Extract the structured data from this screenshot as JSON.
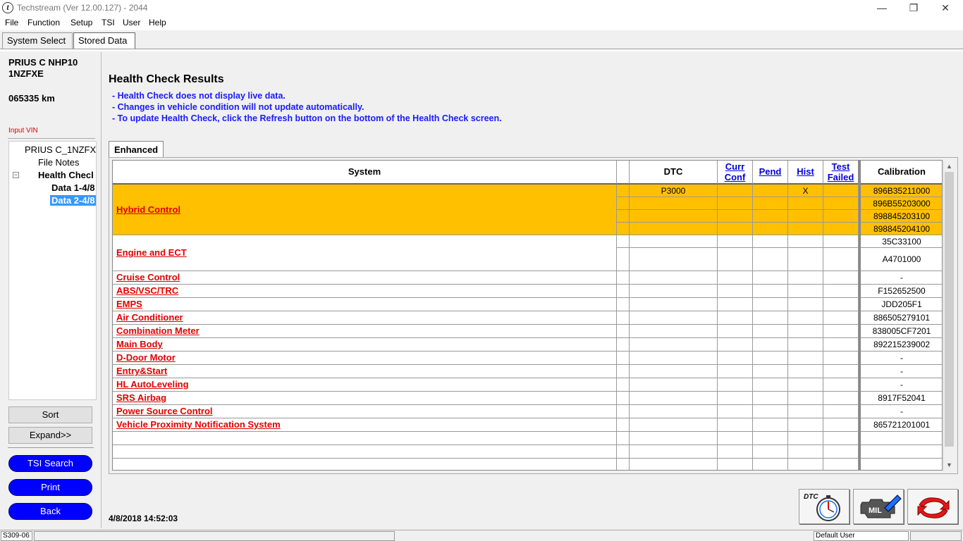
{
  "window": {
    "title": "Techstream (Ver 12.00.127) - 2044",
    "icon_glyph": "t",
    "min_glyph": "—",
    "max_glyph": "❐",
    "close_glyph": "✕"
  },
  "menu": [
    "File",
    "Function",
    "Setup",
    "TSI",
    "User",
    "Help"
  ],
  "tabs": [
    {
      "label": "System Select",
      "active": false
    },
    {
      "label": "Stored Data",
      "active": true
    }
  ],
  "vehicle": {
    "model": "PRIUS C NHP10",
    "engine": "1NZFXE",
    "mileage": "065335 km",
    "input_vin_label": "Input VIN"
  },
  "tree": {
    "root": "PRIUS C_1NZFX",
    "file_notes": "File Notes",
    "health_check": "Health Checl",
    "data1": "Data 1-4/8",
    "data2": "Data 2-4/8",
    "toggle_glyph": "−"
  },
  "left_buttons": {
    "sort": "Sort",
    "expand": "Expand>>",
    "tsi_search": "TSI Search",
    "print": "Print",
    "back": "Back"
  },
  "main": {
    "title": "Health Check Results",
    "notes": [
      "- Health Check does not display live data.",
      "- Changes in vehicle condition will not update automatically.",
      "- To update Health Check, click the Refresh button on the bottom of the Health Check screen."
    ],
    "tab_label": "Enhanced"
  },
  "table": {
    "headers": {
      "system": "System",
      "dtc": "DTC",
      "curr_conf_1": "Curr",
      "curr_conf_2": "Conf",
      "pend": "Pend",
      "hist": "Hist",
      "test_failed_1": "Test",
      "test_failed_2": "Failed",
      "calibration": "Calibration"
    },
    "hybrid": {
      "system": "Hybrid Control",
      "dtc": "P3000",
      "hist": "X",
      "calibrations": [
        "896B35211000",
        "896B55203000",
        "898845203100",
        "898845204100"
      ]
    },
    "engine": {
      "system": "Engine and ECT",
      "calibrations": [
        "35C33100",
        "A4701000"
      ]
    },
    "rows": [
      {
        "system": "Cruise Control",
        "calibration": "-"
      },
      {
        "system": "ABS/VSC/TRC",
        "calibration": "F152652500"
      },
      {
        "system": "EMPS",
        "calibration": "JDD205F1"
      },
      {
        "system": "Air Conditioner",
        "calibration": "886505279101"
      },
      {
        "system": "Combination Meter",
        "calibration": "838005CF7201"
      },
      {
        "system": "Main Body",
        "calibration": "892215239002"
      },
      {
        "system": "D-Door Motor",
        "calibration": "-"
      },
      {
        "system": "Entry&Start",
        "calibration": "-"
      },
      {
        "system": "HL AutoLeveling",
        "calibration": "-"
      },
      {
        "system": "SRS Airbag",
        "calibration": "8917F52041"
      },
      {
        "system": "Power Source Control",
        "calibration": "-"
      },
      {
        "system": "Vehicle Proximity Notification System",
        "calibration": "865721201001"
      }
    ],
    "highlight_color": "#ffc000"
  },
  "footer": {
    "timestamp": "4/8/2018 14:52:03",
    "dtc_icon_label": "DTC",
    "mil_icon_label": "MIL"
  },
  "status": {
    "code": "S309-06",
    "user": "Default User"
  },
  "scroll": {
    "up": "▲",
    "down": "▼"
  }
}
